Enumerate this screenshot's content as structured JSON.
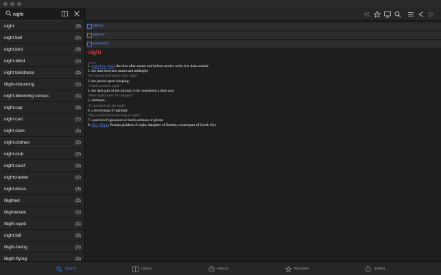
{
  "search": {
    "value": "night",
    "placeholder": "Search"
  },
  "sidebar": {
    "items": [
      {
        "label": "night",
        "count": "(3)"
      },
      {
        "label": "night bell",
        "count": "(1)"
      },
      {
        "label": "night.bird",
        "count": "(3)"
      },
      {
        "label": "night-blind",
        "count": "(1)"
      },
      {
        "label": "night blindness",
        "count": "(2)"
      },
      {
        "label": "Night-blooming",
        "count": "(1)"
      },
      {
        "label": "night-blooming cereus",
        "count": "(1)"
      },
      {
        "label": "night.cap",
        "count": "(3)"
      },
      {
        "label": "night cart",
        "count": "(1)"
      },
      {
        "label": "night clerk",
        "count": "(1)"
      },
      {
        "label": "night.clothes",
        "count": "(2)"
      },
      {
        "label": "night.club",
        "count": "(2)"
      },
      {
        "label": "night court",
        "count": "(1)"
      },
      {
        "label": "nightcrawler",
        "count": "(1)"
      },
      {
        "label": "night.dress",
        "count": "(3)"
      },
      {
        "label": "Nighted",
        "count": "(2)"
      },
      {
        "label": "Nightertale",
        "count": "(1)"
      },
      {
        "label": "Night-eyed",
        "count": "(1)"
      },
      {
        "label": "night.fall",
        "count": "(3)"
      },
      {
        "label": "Night-faring",
        "count": "(1)"
      },
      {
        "label": "Night-flying",
        "count": "(1)"
      }
    ]
  },
  "dictionaries": [
    {
      "name": "CEDict"
    },
    {
      "name": "webster"
    },
    {
      "name": "wordnet30"
    }
  ],
  "entry": {
    "headword": "night",
    "pos": "Nouns",
    "senses": [
      {
        "num": "1.",
        "links": [
          "nighttime",
          "dark"
        ],
        "text": "; the time after sunset and before sunrise while it is dark outside",
        "examples": []
      },
      {
        "num": "2.",
        "links": [],
        "text": "the time between sunset and midnight;",
        "examples": [
          "\"he watched television every night\""
        ]
      },
      {
        "num": "3.",
        "links": [],
        "text": "the period spent sleeping;",
        "examples": [
          "\"I had a restless night\""
        ]
      },
      {
        "num": "4.",
        "links": [],
        "text": "the dark part of the diurnal cycle considered a time unit;",
        "examples": [
          "\"three nights later he collapsed\""
        ]
      },
      {
        "num": "5.",
        "links": [],
        "text": "darkness;",
        "examples": [
          "\"it vanished into the night\""
        ]
      },
      {
        "num": "6.",
        "links": [],
        "text": "a shortening of nightfall;",
        "examples": [
          "\"they worked from morning to night\""
        ]
      },
      {
        "num": "7.",
        "links": [],
        "text": "a period of ignorance or backwardness or gloom",
        "examples": []
      },
      {
        "num": "8.",
        "links": [
          "Nox",
          "Night"
        ],
        "text": "; Roman goddess of night; daughter of Erebus; counterpart of Greek Nyx",
        "examples": []
      }
    ]
  },
  "tabs": {
    "search": "Search",
    "library": "Library",
    "history": "History",
    "favorites": "Favorites",
    "setting": "Setting"
  },
  "colors": {
    "accent": "#3d85e8",
    "headword": "#e03030",
    "link": "#4f7fe0"
  },
  "icons": {
    "toolbar": [
      "back-double-icon",
      "star-icon",
      "monitor-icon",
      "search-icon",
      "list-icon",
      "previous-icon",
      "next-icon"
    ]
  }
}
